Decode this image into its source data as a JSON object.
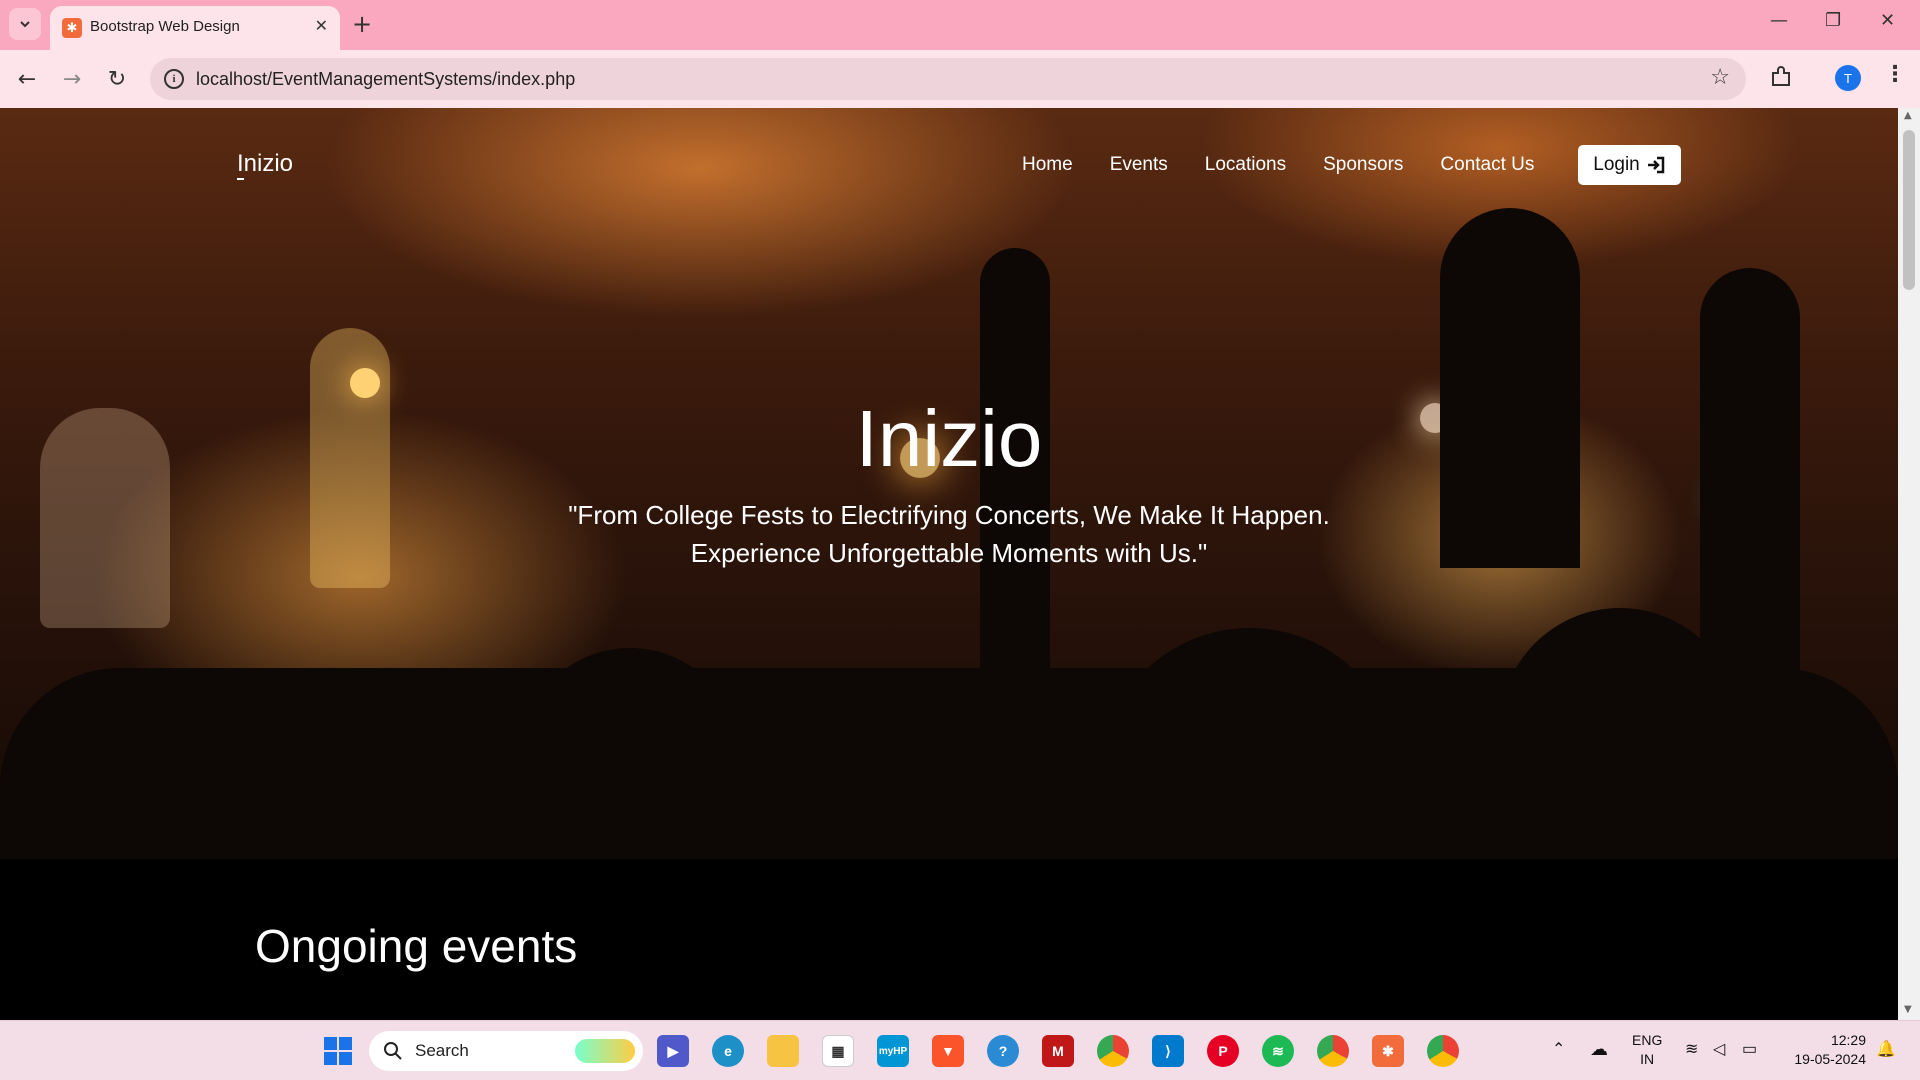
{
  "browser": {
    "tab_title": "Bootstrap Web Design",
    "url": "localhost/EventManagementSystems/index.php",
    "profile_initial": "T",
    "accent": "#f9a8bf"
  },
  "site": {
    "brand": "Inizio",
    "nav": [
      "Home",
      "Events",
      "Locations",
      "Sponsors",
      "Contact Us"
    ],
    "login_label": "Login",
    "hero_title": "Inizio",
    "hero_quote_line1": "\"From College Fests to Electrifying Concerts, We Make It Happen.",
    "hero_quote_line2": "Experience Unforgettable Moments with Us.\"",
    "section_title": "Ongoing events"
  },
  "taskbar": {
    "search_label": "Search",
    "apps": [
      "windows-start",
      "search",
      "teams-meet",
      "edge",
      "file-explorer",
      "microsoft-store",
      "myhp",
      "brave",
      "help",
      "mcafee",
      "chrome",
      "vscode",
      "pinterest",
      "spotify",
      "chrome-profile",
      "xampp",
      "chrome-active"
    ],
    "lang_line1": "ENG",
    "lang_line2": "IN",
    "time": "12:29",
    "date": "19-05-2024"
  }
}
